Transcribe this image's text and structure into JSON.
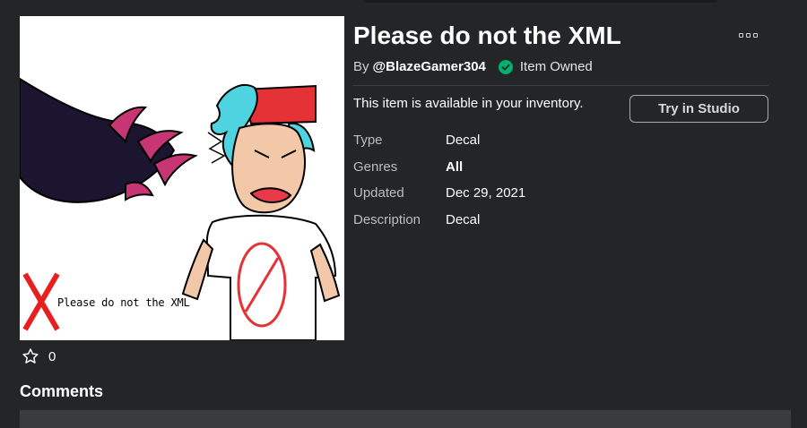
{
  "item": {
    "title": "Please do not the XML",
    "by_label": "By",
    "creator": "@BlazeGamer304",
    "owned_text": "Item Owned",
    "availability": "This item is available in your inventory.",
    "try_button": "Try in Studio"
  },
  "details": [
    {
      "label": "Type",
      "value": "Decal"
    },
    {
      "label": "Genres",
      "value": "All"
    },
    {
      "label": "Updated",
      "value": "Dec 29, 2021"
    },
    {
      "label": "Description",
      "value": "Decal"
    }
  ],
  "thumbnail": {
    "caption": "Please do not the XML"
  },
  "favorites": {
    "count": "0"
  },
  "comments": {
    "title": "Comments"
  },
  "colors": {
    "background": "#232527",
    "accent_owned": "#00b06f",
    "text": "#ffffff"
  },
  "icons": {
    "owned": "check-circle-icon",
    "favorite": "star-outline-icon",
    "more": "ellipsis-icon"
  }
}
